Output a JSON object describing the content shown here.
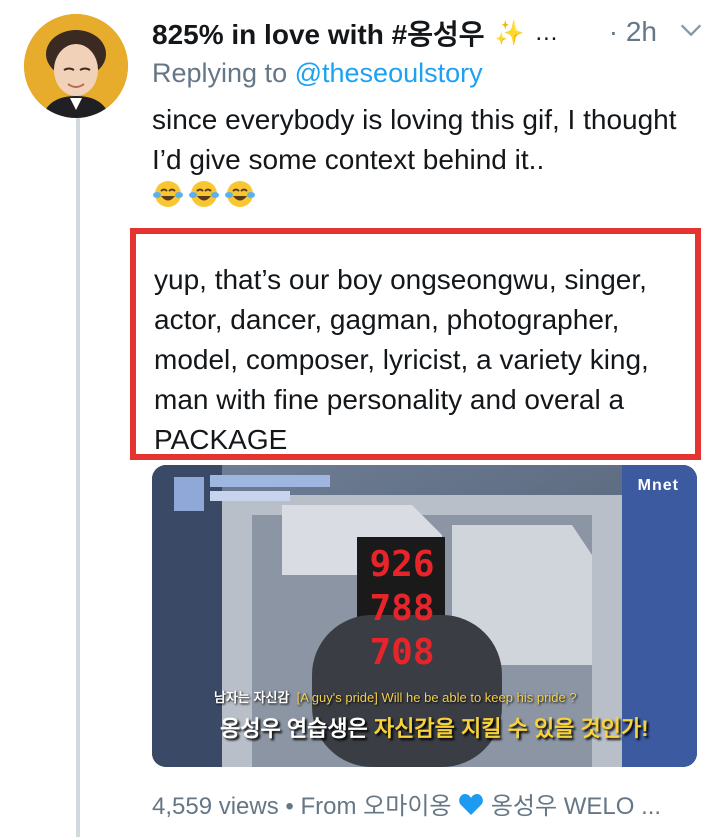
{
  "tweet": {
    "display_name": "825% in love with #옹성우",
    "timestamp": "2h",
    "replying_prefix": "Replying to",
    "replying_handle": "@theseoulstory",
    "text": "since everybody is loving this gif, I thought I’d give some context behind it..",
    "emojis": [
      "face-with-tears-of-joy-icon",
      "face-with-tears-of-joy-icon",
      "face-with-tears-of-joy-icon"
    ]
  },
  "quote": {
    "text": "yup, that’s our boy ongseongwu, singer, actor, dancer, gagman, photographer, model, composer, lyricist, a variety king, man with fine personality and overal a PACKAGE",
    "highlight_color": "#e5342f"
  },
  "media": {
    "logo_text": "Mnet",
    "scores": [
      "926",
      "788",
      "708"
    ],
    "caption_small": "남자는 자신감",
    "caption_en": "[A guy's pride] Will he be able to keep his pride ?",
    "caption_white": "옹성우 연습생은",
    "caption_yellow": "자신감을 지킬 수 있을 것인가!"
  },
  "footer": {
    "views": "4,559 views",
    "separator": "•",
    "from_label": "From 오마이옹",
    "source_name": "옹성우 WELO ...",
    "heart_color": "#1d9bf0"
  },
  "colors": {
    "link": "#1da1f2",
    "muted": "#657786",
    "thread_line": "#cfd9de"
  }
}
